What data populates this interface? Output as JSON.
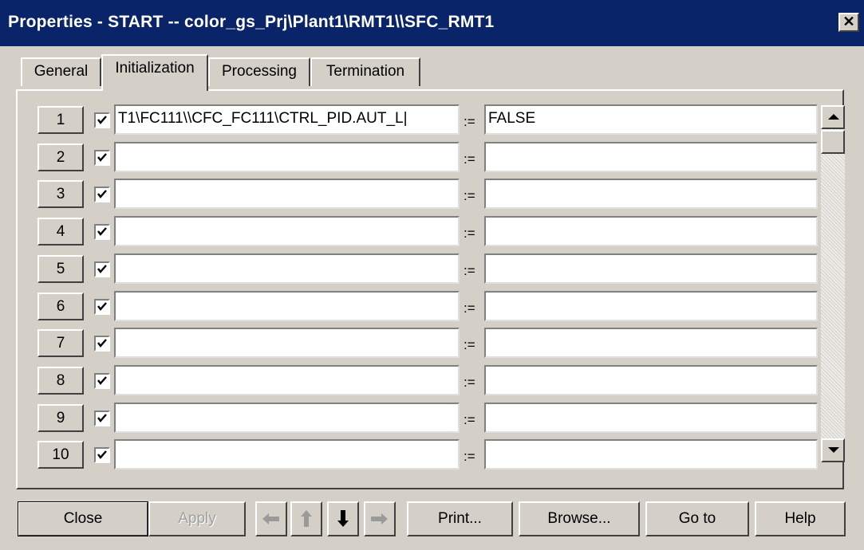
{
  "window": {
    "title": "Properties - START -- color_gs_Prj\\Plant1\\RMT1\\\\SFC_RMT1",
    "close_glyph": "✕"
  },
  "tabs": [
    {
      "label": "General",
      "active": false
    },
    {
      "label": "Initialization",
      "active": true
    },
    {
      "label": "Processing",
      "active": false
    },
    {
      "label": "Termination",
      "active": false
    }
  ],
  "rows": [
    {
      "num": "1",
      "checked": true,
      "left": "T1\\FC111\\\\CFC_FC111\\CTRL_PID.AUT_L|",
      "assign": ":=",
      "right": "FALSE"
    },
    {
      "num": "2",
      "checked": true,
      "left": "",
      "assign": ":=",
      "right": ""
    },
    {
      "num": "3",
      "checked": true,
      "left": "",
      "assign": ":=",
      "right": ""
    },
    {
      "num": "4",
      "checked": true,
      "left": "",
      "assign": ":=",
      "right": ""
    },
    {
      "num": "5",
      "checked": true,
      "left": "",
      "assign": ":=",
      "right": ""
    },
    {
      "num": "6",
      "checked": true,
      "left": "",
      "assign": ":=",
      "right": ""
    },
    {
      "num": "7",
      "checked": true,
      "left": "",
      "assign": ":=",
      "right": ""
    },
    {
      "num": "8",
      "checked": true,
      "left": "",
      "assign": ":=",
      "right": ""
    },
    {
      "num": "9",
      "checked": true,
      "left": "",
      "assign": ":=",
      "right": ""
    },
    {
      "num": "10",
      "checked": true,
      "left": "",
      "assign": ":=",
      "right": ""
    }
  ],
  "buttons": {
    "close": "Close",
    "apply": "Apply",
    "print": "Print...",
    "browse": "Browse...",
    "goto": "Go to",
    "help": "Help"
  },
  "icons": {
    "arrow_left": "arrow-left-icon",
    "arrow_up": "arrow-up-icon",
    "arrow_down": "arrow-down-icon",
    "arrow_right": "arrow-right-icon",
    "scroll_up": "scroll-up-icon",
    "scroll_down": "scroll-down-icon"
  },
  "colors": {
    "titlebar": "#0a246a",
    "face": "#d4d0c8",
    "disabled": "#a0a0a0"
  }
}
